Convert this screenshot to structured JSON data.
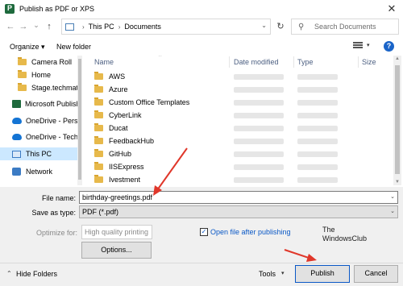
{
  "window": {
    "title": "Publish as PDF or XPS",
    "close_glyph": "✕"
  },
  "nav": {
    "back_glyph": "←",
    "forward_glyph": "→",
    "recent_glyph": "⌄",
    "up_glyph": "↑",
    "breadcrumb": [
      "This PC",
      "Documents"
    ],
    "refresh_glyph": "↻",
    "search_placeholder": "Search Documents"
  },
  "toolbar": {
    "organize_label": "Organize ▾",
    "new_folder_label": "New folder",
    "help_glyph": "?"
  },
  "sidebar": {
    "items": [
      {
        "label": "Camera Roll",
        "icon": "folder-icon"
      },
      {
        "label": "Home",
        "icon": "folder-icon"
      },
      {
        "label": "Stage.techmate",
        "icon": "folder-icon"
      },
      {
        "label": "Microsoft Publisher",
        "icon": "publisher-icon"
      },
      {
        "label": "OneDrive - Personal",
        "icon": "cloud-icon"
      },
      {
        "label": "OneDrive - TechM",
        "icon": "cloud-icon"
      },
      {
        "label": "This PC",
        "icon": "pc-icon",
        "selected": true
      },
      {
        "label": "Network",
        "icon": "network-icon"
      }
    ]
  },
  "filelist": {
    "columns": [
      "Name",
      "Date modified",
      "Type",
      "Size"
    ],
    "files": [
      "AWS",
      "Azure",
      "Custom Office Templates",
      "CyberLink",
      "Ducat",
      "FeedbackHub",
      "GitHub",
      "IISExpress",
      "Ivestment"
    ]
  },
  "form": {
    "file_name_label": "File name:",
    "file_name_value": "birthday-greetings.pdf",
    "save_type_label": "Save as type:",
    "save_type_value": "PDF (*.pdf)",
    "optimize_label": "Optimize for:",
    "optimize_value": "High quality printing",
    "options_label": "Options...",
    "open_after_label": "Open file after publishing",
    "open_after_checked": true,
    "check_glyph": "✓"
  },
  "watermark": {
    "line1": "The",
    "line2": "WindowsClub"
  },
  "footer": {
    "hide_folders_label": "Hide Folders",
    "tools_label": "Tools",
    "publish_label": "Publish",
    "cancel_label": "Cancel"
  },
  "colors": {
    "accent": "#0a58c6",
    "selection": "#cce8ff",
    "annotation_arrow": "#e0372a"
  }
}
